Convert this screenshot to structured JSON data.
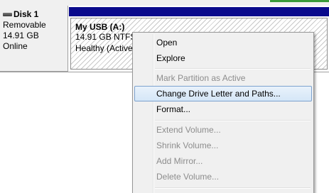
{
  "disk": {
    "name": "Disk 1",
    "type": "Removable",
    "size": "14.91 GB",
    "status": "Online"
  },
  "volume": {
    "title": "My USB  (A:)",
    "size_fs": "14.91 GB NTFS",
    "health": "Healthy (Active"
  },
  "context_menu": {
    "items": [
      {
        "label": "Open",
        "enabled": true
      },
      {
        "label": "Explore",
        "enabled": true
      },
      {
        "label": "Mark Partition as Active",
        "enabled": false
      },
      {
        "label": "Change Drive Letter and Paths...",
        "enabled": true,
        "highlighted": true
      },
      {
        "label": "Format...",
        "enabled": true
      },
      {
        "label": "Extend Volume...",
        "enabled": false
      },
      {
        "label": "Shrink Volume...",
        "enabled": false
      },
      {
        "label": "Add Mirror...",
        "enabled": false
      },
      {
        "label": "Delete Volume...",
        "enabled": false
      }
    ]
  },
  "colors": {
    "volume_header": "#0a0a8c",
    "highlight_border": "#7da2ce",
    "disabled_text": "#8d8d8d"
  }
}
